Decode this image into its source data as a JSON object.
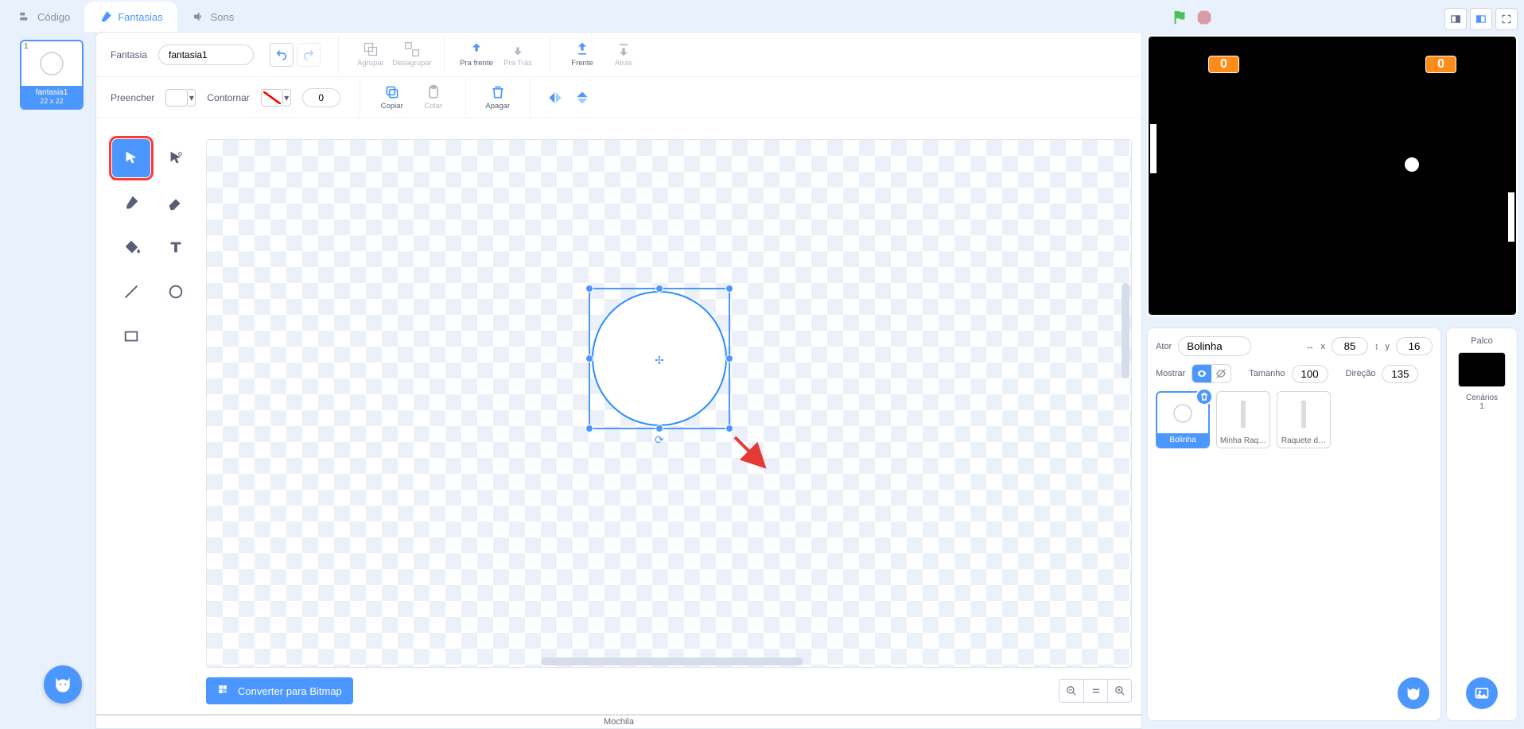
{
  "tabs": {
    "code": "Código",
    "costumes": "Fantasias",
    "sounds": "Sons"
  },
  "costume_thumb": {
    "index": "1",
    "name": "fantasia1",
    "dims": "22 x 22"
  },
  "toolbar": {
    "costume_label": "Fantasia",
    "costume_name": "fantasia1",
    "group": "Agrupar",
    "ungroup": "Desagrupar",
    "forward": "Pra frente",
    "backward": "Pra Trás",
    "front": "Frente",
    "back": "Atrás",
    "fill_label": "Preencher",
    "outline_label": "Contornar",
    "outline_width": "0",
    "copy": "Copiar",
    "paste": "Colar",
    "delete": "Apagar"
  },
  "bitmap_button": "Converter para Bitmap",
  "stage": {
    "score_left": "0",
    "score_right": "0"
  },
  "sprite_info": {
    "ator_label": "Ator",
    "name": "Bolinha",
    "x_label": "x",
    "x": "85",
    "y_label": "y",
    "y": "16",
    "show_label": "Mostrar",
    "size_label": "Tamanho",
    "size": "100",
    "dir_label": "Direção",
    "dir": "135"
  },
  "sprites": [
    "Bolinha",
    "Minha Raq…",
    "Raquete d…"
  ],
  "palco": {
    "title": "Palco",
    "scenes_label": "Cenários",
    "scenes_count": "1"
  },
  "backpack": "Mochila"
}
